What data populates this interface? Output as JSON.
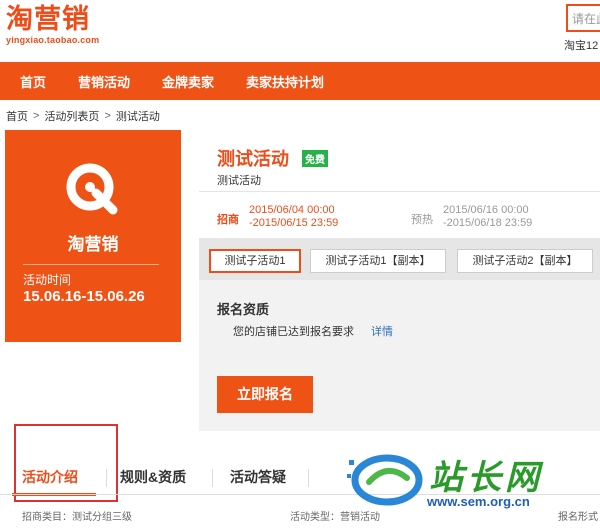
{
  "header": {
    "logo_title": "淘营销",
    "logo_sub": "yingxiao.taobao.com",
    "search_placeholder": "请在此",
    "sub_text": "淘宝12"
  },
  "nav": {
    "items": [
      "首页",
      "营销活动",
      "金牌卖家",
      "卖家扶持计划"
    ]
  },
  "breadcrumb": {
    "items": [
      "首页",
      "活动列表页",
      "测试活动"
    ],
    "separator": ">"
  },
  "promo": {
    "name": "淘营销",
    "time_label": "活动时间",
    "time_range": "15.06.16-15.06.26",
    "icon": "search-magnifier-icon",
    "color": "#ef5215"
  },
  "activity": {
    "title": "测试活动",
    "badge": "免费",
    "subtitle": "测试活动",
    "recruit_label": "招商",
    "recruit_start": "2015/06/04 00:00",
    "recruit_end": "-2015/06/15 23:59",
    "preheat_label": "预热",
    "preheat_start": "2015/06/16 00:00",
    "preheat_end": "-2015/06/18 23:59"
  },
  "subtabs": [
    "测试子活动1",
    "测试子活动1【副本】",
    "测试子活动2【副本】"
  ],
  "qualification": {
    "title": "报名资质",
    "text": "您的店铺已达到报名要求",
    "link": "详情"
  },
  "apply_button": "立即报名",
  "tabs": [
    "活动介绍",
    "规则&资质",
    "活动答疑"
  ],
  "info_row": {
    "category": "招商类目：测试分组三级",
    "type": "活动类型：营销活动",
    "form": "报名形式"
  },
  "watermark": {
    "text": "站长网",
    "url": "www.sem.org.cn"
  },
  "colors": {
    "brand": "#ef5215",
    "badge_green": "#28b04b",
    "link_blue": "#2b6fb7",
    "highlight_red": "#e03030"
  }
}
